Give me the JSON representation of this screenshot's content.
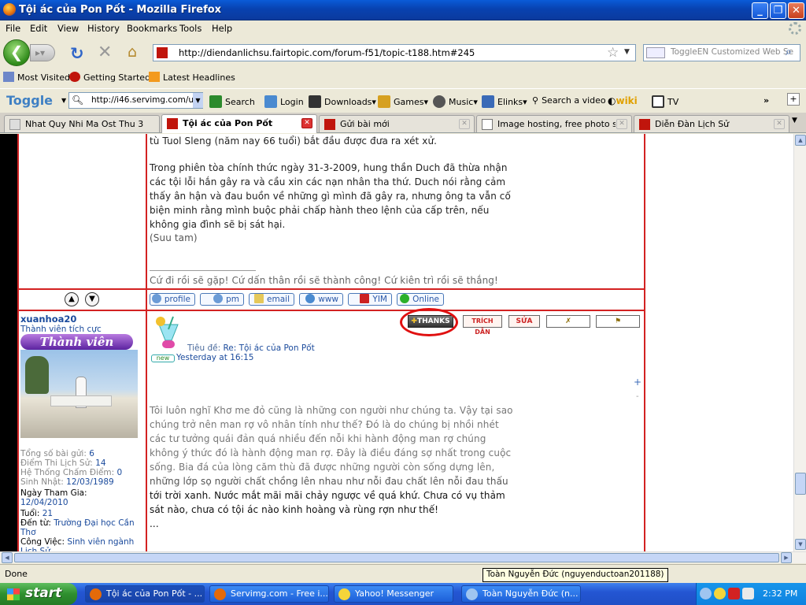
{
  "window": {
    "title": "Tội ác của Pon Pốt - Mozilla Firefox"
  },
  "menus": [
    "File",
    "Edit",
    "View",
    "History",
    "Bookmarks",
    "Tools",
    "Help"
  ],
  "nav": {
    "url": "http://diendanlichsu.fairtopic.com/forum-f51/topic-t188.htm#245",
    "search_placeholder": "ToggleEN Customized Web Se"
  },
  "bookmarks": [
    "Most Visited",
    "Getting Started",
    "Latest Headlines"
  ],
  "toggle_toolbar": {
    "logo": "Toggle",
    "url": "http://i46.servimg.com/u,",
    "items": [
      "Search",
      "Login",
      "Downloads",
      "Games",
      "Music",
      "Elinks",
      "Search a video",
      "wiki",
      "TV"
    ],
    "more": "»"
  },
  "tabs": [
    {
      "label": "Nhat Quy Nhi Ma Ost Thu 3 ...",
      "active": false
    },
    {
      "label": "Tội ác của Pon Pốt",
      "active": true
    },
    {
      "label": "Gửi bài mới",
      "active": false
    },
    {
      "label": "Image hosting, free photo s...",
      "active": false
    },
    {
      "label": "Diễn Đàn Lịch Sử",
      "active": false
    }
  ],
  "post1": {
    "line_top": "tù Tuol Sleng (năm nay 66 tuổi) bắt đầu được đưa ra xét xử.",
    "paragraph": [
      "Trong phiên tòa chính thức ngày 31-3-2009, hung thần Duch đã thừa nhận",
      "các tội lỗi hắn gây ra và cầu xin các nạn nhân tha thứ. Duch nói rằng cảm",
      "thấy ân hận và đau buồn về những gì mình đã gây ra, nhưng ông ta vẫn cố",
      "biện minh rằng mình buộc phải chấp hành theo lệnh của cấp trên, nếu",
      "không gia đình sẽ bị sát hại."
    ],
    "source": "(Suu tam)",
    "signature": "Cứ đi rồi sẽ gặp! Cứ dấn thân rồi sẽ thành công! Cứ kiên trì rồi sẽ thắng!",
    "buttons": [
      "profile",
      "pm",
      "email",
      "www",
      "YIM",
      "Online"
    ]
  },
  "post2": {
    "username": "xuanhoa20",
    "rank": "Thành viên tích cực",
    "rank_badge": "Thành viên",
    "stats": [
      {
        "label": "Tổng số bài gửi:",
        "value": "6"
      },
      {
        "label": "Điểm Thi Lịch Sử:",
        "value": "14"
      },
      {
        "label": "Hệ Thống Chấm Điểm:",
        "value": "0"
      },
      {
        "label": "Sinh Nhật:",
        "value": "12/03/1989"
      }
    ],
    "stats2": [
      {
        "label": "Ngày Tham Gia:",
        "value": "12/04/2010"
      },
      {
        "label": "Tuổi:",
        "value": "21"
      },
      {
        "label": "Đến từ:",
        "value": "Trường Đại học Cần Thơ"
      },
      {
        "label": "Công Việc:",
        "value": "Sinh viên ngành Lịch Sử"
      }
    ],
    "title_label": "Tiêu đề:",
    "title": "Re: Tội ác của Pon Pốt",
    "new_badge": "new",
    "date": "Yesterday at 16:15",
    "actions": {
      "thanks": "THANKS",
      "quote": "TRÍCH DẪN",
      "edit": "SỬA"
    },
    "body": [
      "Tôi luôn nghĩ Khơ me đỏ cũng là những con người như chúng ta. Vậy tại sao",
      "chúng trở nên man rợ vô nhân tính như thế? Đó là do chúng bị nhồi nhét",
      "các tư tưởng quái đản quá nhiều đến nỗi khi hành động man rợ chúng",
      "không ý thức đó là hành động man rợ. Đây là điều đáng sợ nhất trong cuộc",
      "sống. Bia đá của lòng căm thù đã được những người còn sống dựng lên,",
      "những lớp sọ người chất chồng lên nhau như nỗi đau chất lên nỗi đau thấu",
      "tới trời xanh. Nước mắt mãi mãi chảy ngược về quá khứ. Chưa có vụ thảm",
      "sát nào, chưa có tội ác nào kinh hoàng và rùng rợn như thế!",
      "..."
    ]
  },
  "status": {
    "text": "Done",
    "tooltip": "Toàn Nguyễn Đức (nguyenductoan201188)"
  },
  "taskbar": {
    "start": "start",
    "tasks": [
      "Tội ác của Pon Pốt - ...",
      "Servimg.com - Free i...",
      "Yahoo! Messenger",
      "Toàn Nguyễn Đức (n..."
    ],
    "clock": "2:32 PM"
  }
}
